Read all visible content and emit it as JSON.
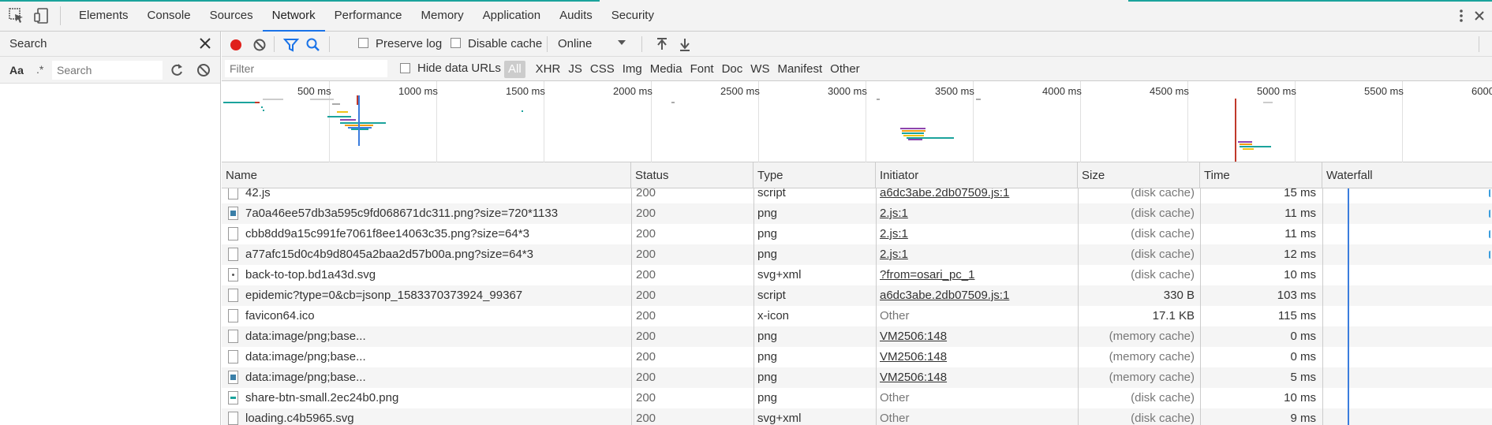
{
  "devtools": {
    "tabs": [
      "Elements",
      "Console",
      "Sources",
      "Network",
      "Performance",
      "Memory",
      "Application",
      "Audits",
      "Security"
    ],
    "active_tab": "Network",
    "accent_color": "#1ba39c"
  },
  "search_pane": {
    "title": "Search",
    "case_label": "Aa",
    "regex_label": ".*",
    "placeholder": "Search"
  },
  "toolbar": {
    "preserve_log": "Preserve log",
    "disable_cache": "Disable cache",
    "throttle": "Online",
    "record_color": "#e0201b"
  },
  "filter": {
    "placeholder": "Filter",
    "hide_data_urls": "Hide data URLs",
    "types": [
      "All",
      "XHR",
      "JS",
      "CSS",
      "Img",
      "Media",
      "Font",
      "Doc",
      "WS",
      "Manifest",
      "Other"
    ],
    "active_type": "All"
  },
  "overview": {
    "ticks": [
      "500 ms",
      "1000 ms",
      "1500 ms",
      "2000 ms",
      "2500 ms",
      "3000 ms",
      "3500 ms",
      "4000 ms",
      "4500 ms",
      "5000 ms",
      "5500 ms",
      "6000"
    ]
  },
  "table": {
    "columns": [
      "Name",
      "Status",
      "Type",
      "Initiator",
      "Size",
      "Time",
      "Waterfall"
    ],
    "rows": [
      {
        "name": "42.js",
        "status": "200",
        "type": "script",
        "initiator": "a6dc3abe.2db07509.js:1",
        "size": "(disk cache)",
        "time": "15 ms",
        "icon": "file"
      },
      {
        "name": "7a0a46ee57db3a595c9fd068671dc311.png?size=720*1133",
        "status": "200",
        "type": "png",
        "initiator": "2.js:1",
        "size": "(disk cache)",
        "time": "11 ms",
        "icon": "img"
      },
      {
        "name": "cbb8dd9a15c991fe7061f8ee14063c35.png?size=64*3",
        "status": "200",
        "type": "png",
        "initiator": "2.js:1",
        "size": "(disk cache)",
        "time": "11 ms",
        "icon": "file"
      },
      {
        "name": "a77afc15d0c4b9d8045a2baa2d57b00a.png?size=64*3",
        "status": "200",
        "type": "png",
        "initiator": "2.js:1",
        "size": "(disk cache)",
        "time": "12 ms",
        "icon": "file"
      },
      {
        "name": "back-to-top.bd1a43d.svg",
        "status": "200",
        "type": "svg+xml",
        "initiator": "?from=osari_pc_1",
        "size": "(disk cache)",
        "time": "10 ms",
        "icon": "svg"
      },
      {
        "name": "epidemic?type=0&cb=jsonp_1583370373924_99367",
        "status": "200",
        "type": "script",
        "initiator": "a6dc3abe.2db07509.js:1",
        "size": "330 B",
        "time": "103 ms",
        "icon": "file"
      },
      {
        "name": "favicon64.ico",
        "status": "200",
        "type": "x-icon",
        "initiator": "Other",
        "size": "17.1 KB",
        "time": "115 ms",
        "icon": "file"
      },
      {
        "name": "data:image/png;base...",
        "status": "200",
        "type": "png",
        "initiator": "VM2506:148",
        "size": "(memory cache)",
        "time": "0 ms",
        "icon": "file"
      },
      {
        "name": "data:image/png;base...",
        "status": "200",
        "type": "png",
        "initiator": "VM2506:148",
        "size": "(memory cache)",
        "time": "0 ms",
        "icon": "file"
      },
      {
        "name": "data:image/png;base...",
        "status": "200",
        "type": "png",
        "initiator": "VM2506:148",
        "size": "(memory cache)",
        "time": "5 ms",
        "icon": "img"
      },
      {
        "name": "share-btn-small.2ec24b0.png",
        "status": "200",
        "type": "png",
        "initiator": "Other",
        "size": "(disk cache)",
        "time": "10 ms",
        "icon": "share"
      },
      {
        "name": "loading.c4b5965.svg",
        "status": "200",
        "type": "svg+xml",
        "initiator": "Other",
        "size": "(disk cache)",
        "time": "9 ms",
        "icon": "file"
      }
    ]
  }
}
